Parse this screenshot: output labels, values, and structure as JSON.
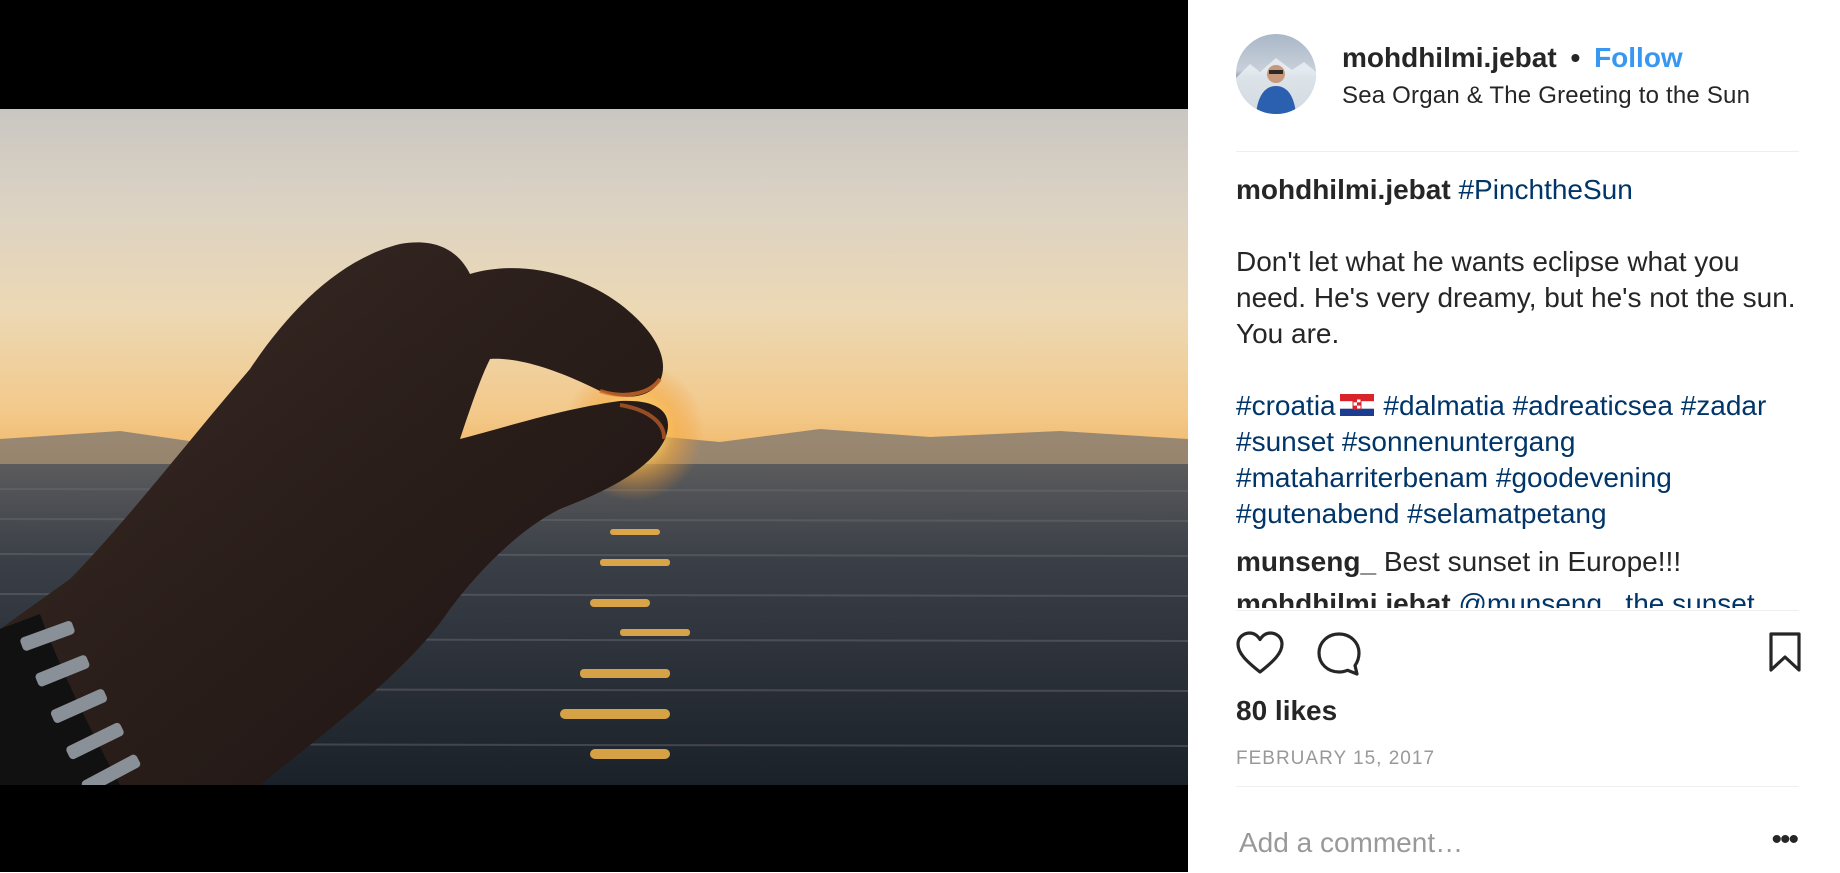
{
  "post": {
    "username": "mohdhilmi.jebat",
    "separator": "•",
    "follow_label": "Follow",
    "location": "Sea Organ & The Greeting to the Sun"
  },
  "caption": {
    "username": "mohdhilmi.jebat",
    "title_tag": "#PinchtheSun",
    "body": "Don't let what he wants eclipse what you need. He's very dreamy, but he's not the sun. You are.",
    "tags_line1a": "#croatia",
    "tags_line1b": "#dalmatia #adreaticsea #zadar",
    "tags_line2": "#sunset #sonnenuntergang",
    "tags_line3": "#mataharriterbenam #goodevening",
    "tags_line4": "#gutenabend #selamatpetang"
  },
  "comments": [
    {
      "user": "munseng_",
      "text": "Best sunset in Europe!!!"
    },
    {
      "user": "mohdhilmi.jebat",
      "text": "@munseng_ the sunset"
    }
  ],
  "actions": {
    "like_icon": "heart-icon",
    "comment_icon": "speech-bubble-icon",
    "save_icon": "bookmark-icon"
  },
  "likes": "80 likes",
  "date": "FEBRUARY 15, 2017",
  "add_comment": {
    "placeholder": "Add a comment…",
    "more": "•••"
  },
  "colors": {
    "link": "#003569",
    "follow": "#3897f0",
    "muted": "#999999",
    "text": "#262626"
  }
}
